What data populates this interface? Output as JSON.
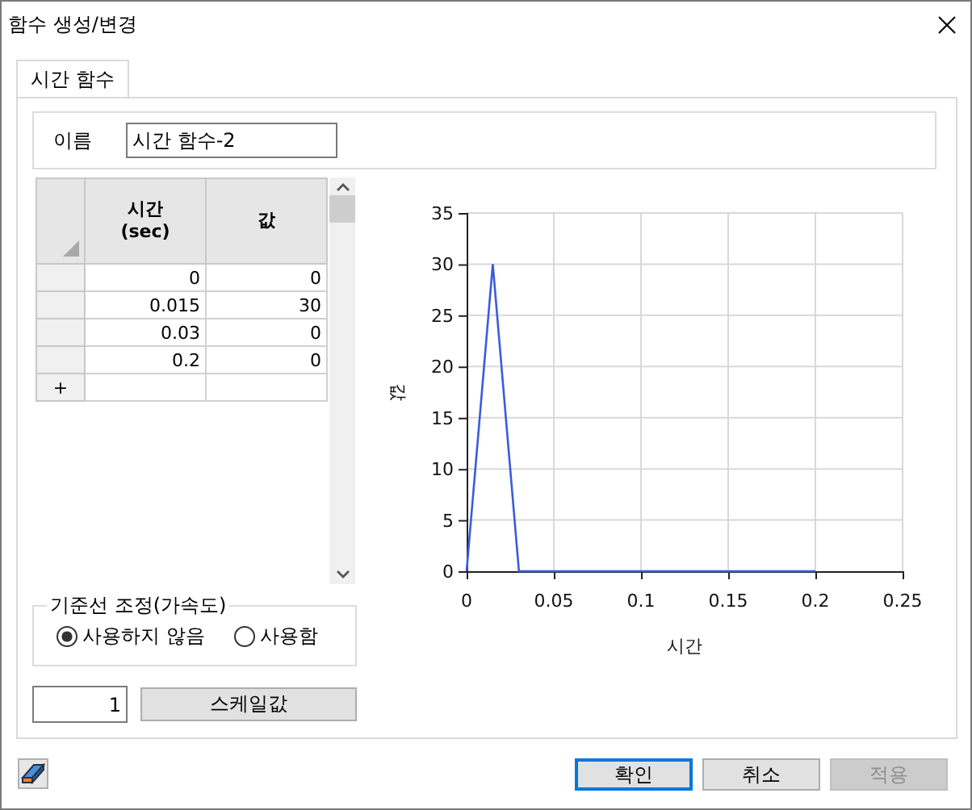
{
  "window": {
    "title": "함수 생성/변경"
  },
  "tabs": [
    {
      "label": "시간 함수",
      "selected": true
    }
  ],
  "name_field": {
    "label": "이름",
    "value": "시간 함수-2"
  },
  "table": {
    "columns": [
      "시간\n(sec)",
      "값"
    ],
    "rows": [
      [
        "0",
        "0"
      ],
      [
        "0.015",
        "30"
      ],
      [
        "0.03",
        "0"
      ],
      [
        "0.2",
        "0"
      ]
    ],
    "new_row_marker": "+"
  },
  "baseline_group": {
    "title": "기준선 조정(가속도)",
    "options": [
      {
        "label": "사용하지 않음",
        "selected": true
      },
      {
        "label": "사용함",
        "selected": false
      }
    ]
  },
  "scale": {
    "value": "1",
    "button": "스케일값"
  },
  "chart": {
    "chart_data": {
      "type": "line",
      "xlabel": "시간",
      "ylabel": "값",
      "x": [
        0,
        0.015,
        0.03,
        0.2
      ],
      "series": [
        {
          "color": "#3b5bdb",
          "values": [
            0,
            30,
            0,
            0
          ]
        }
      ],
      "grid": true,
      "xlim": [
        0,
        0.25
      ],
      "ylim": [
        0,
        35
      ],
      "xticks": [
        0,
        0.05,
        0.1,
        0.15,
        0.2,
        0.25
      ],
      "yticks": [
        0,
        5,
        10,
        15,
        20,
        25,
        30,
        35
      ]
    }
  },
  "buttons": [
    {
      "label": "확인",
      "default": true,
      "disabled": false
    },
    {
      "label": "취소",
      "default": false,
      "disabled": false
    },
    {
      "label": "적용",
      "default": false,
      "disabled": true
    }
  ]
}
